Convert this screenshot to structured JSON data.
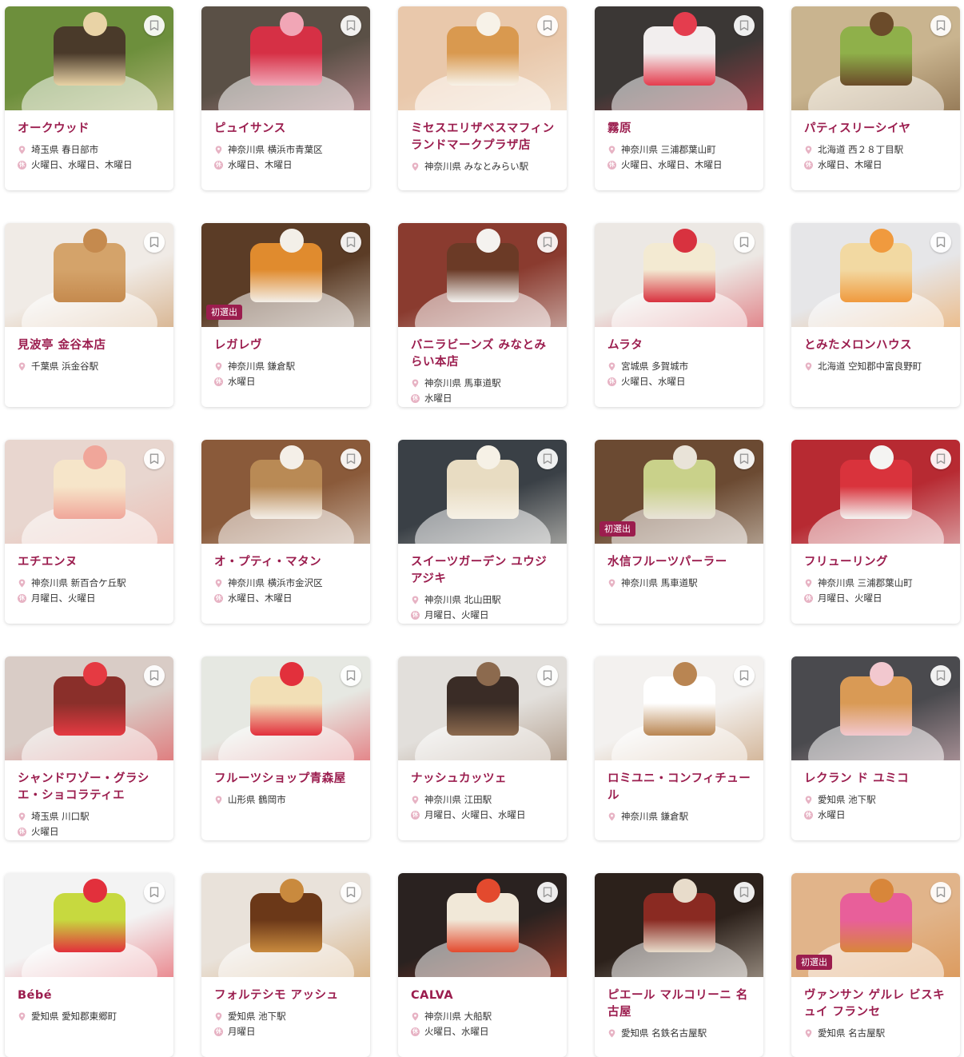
{
  "accent_color": "#9b1d4e",
  "shops": [
    {
      "name": "オークウッド",
      "location": "埼玉県 春日部市",
      "closed": "火曜日、水曜日、木曜日",
      "badge": "",
      "colors": [
        "#6d8f3c",
        "#4a3a2a",
        "#e9d3a6"
      ]
    },
    {
      "name": "ピュイサンス",
      "location": "神奈川県 横浜市青葉区",
      "closed": "水曜日、木曜日",
      "badge": "",
      "colors": [
        "#5a5046",
        "#d63045",
        "#f1a6b6"
      ]
    },
    {
      "name": "ミセスエリザベスマフィン ランドマークプラザ店",
      "location": "神奈川県 みなとみらい駅",
      "closed": "",
      "badge": "",
      "colors": [
        "#e9c8ab",
        "#d9994f",
        "#f7f2e8"
      ]
    },
    {
      "name": "霧原",
      "location": "神奈川県 三浦郡葉山町",
      "closed": "火曜日、水曜日、木曜日",
      "badge": "",
      "colors": [
        "#3b3735",
        "#f2eeee",
        "#e43d4e"
      ]
    },
    {
      "name": "パティスリーシイヤ",
      "location": "北海道 西２８丁目駅",
      "closed": "水曜日、木曜日",
      "badge": "",
      "colors": [
        "#c9b48f",
        "#8fb04a",
        "#6b4b2a"
      ]
    },
    {
      "name": "見波亭 金谷本店",
      "location": "千葉県 浜金谷駅",
      "closed": "",
      "badge": "",
      "colors": [
        "#f0ebe6",
        "#d4a36a",
        "#c58a4e"
      ]
    },
    {
      "name": "レガレヴ",
      "location": "神奈川県 鎌倉駅",
      "closed": "水曜日",
      "badge": "初選出",
      "colors": [
        "#5b3c26",
        "#e08b2e",
        "#f3efe8"
      ]
    },
    {
      "name": "バニラビーンズ みなとみらい本店",
      "location": "神奈川県 馬車道駅",
      "closed": "水曜日",
      "badge": "",
      "colors": [
        "#8a3b2f",
        "#6b3a26",
        "#f4f2ef"
      ]
    },
    {
      "name": "ムラタ",
      "location": "宮城県 多賀城市",
      "closed": "火曜日、水曜日",
      "badge": "",
      "colors": [
        "#ece8e4",
        "#f3ead2",
        "#d8323f"
      ]
    },
    {
      "name": "とみたメロンハウス",
      "location": "北海道 空知郡中富良野町",
      "closed": "",
      "badge": "",
      "colors": [
        "#e6e6e8",
        "#f2d9a2",
        "#f09a3e"
      ]
    },
    {
      "name": "エチエンヌ",
      "location": "神奈川県 新百合ケ丘駅",
      "closed": "月曜日、火曜日",
      "badge": "",
      "colors": [
        "#e8d6cf",
        "#f6e5c9",
        "#f0a69a"
      ]
    },
    {
      "name": "オ・プティ・マタン",
      "location": "神奈川県 横浜市金沢区",
      "closed": "水曜日、木曜日",
      "badge": "",
      "colors": [
        "#8a5a3a",
        "#b98a55",
        "#f4efe8"
      ]
    },
    {
      "name": "スイーツガーデン ユウジアジキ",
      "location": "神奈川県 北山田駅",
      "closed": "月曜日、火曜日",
      "badge": "",
      "colors": [
        "#3a4046",
        "#e8dcc2",
        "#f6f1e6"
      ]
    },
    {
      "name": "水信フルーツパーラー",
      "location": "神奈川県 馬車道駅",
      "closed": "",
      "badge": "初選出",
      "colors": [
        "#6b4a32",
        "#c9d18a",
        "#e9e3d8"
      ]
    },
    {
      "name": "フリューリング",
      "location": "神奈川県 三浦郡葉山町",
      "closed": "月曜日、火曜日",
      "badge": "",
      "colors": [
        "#b72a32",
        "#d9333c",
        "#f4f4f2"
      ]
    },
    {
      "name": "シャンドワゾー・グラシエ・ショコラティエ",
      "location": "埼玉県 川口駅",
      "closed": "火曜日",
      "badge": "",
      "colors": [
        "#d9ccc6",
        "#8a2f2a",
        "#e53a42"
      ]
    },
    {
      "name": "フルーツショップ青森屋",
      "location": "山形県 鶴岡市",
      "closed": "",
      "badge": "",
      "colors": [
        "#e6e8e2",
        "#f2dfb6",
        "#e2303c"
      ]
    },
    {
      "name": "ナッシュカッツェ",
      "location": "神奈川県 江田駅",
      "closed": "月曜日、火曜日、水曜日",
      "badge": "",
      "colors": [
        "#e2dfdb",
        "#3a2c26",
        "#8c6a4e"
      ]
    },
    {
      "name": "ロミユニ・コンフィチュール",
      "location": "神奈川県 鎌倉駅",
      "closed": "",
      "badge": "",
      "colors": [
        "#f3f1ef",
        "#ffffff",
        "#b98552"
      ]
    },
    {
      "name": "レクラン ド ユミコ",
      "location": "愛知県 池下駅",
      "closed": "水曜日",
      "badge": "",
      "colors": [
        "#4a4a4e",
        "#d99a55",
        "#f2c8cf"
      ]
    },
    {
      "name": "Bébé",
      "location": "愛知県 愛知郡東郷町",
      "closed": "",
      "badge": "",
      "colors": [
        "#f3f3f3",
        "#c7d93f",
        "#e2303c"
      ]
    },
    {
      "name": "フォルテシモ アッシュ",
      "location": "愛知県 池下駅",
      "closed": "月曜日",
      "badge": "",
      "colors": [
        "#e9e2da",
        "#6b3818",
        "#c98a3e"
      ]
    },
    {
      "name": "CALVA",
      "location": "神奈川県 大船駅",
      "closed": "火曜日、水曜日",
      "badge": "",
      "colors": [
        "#2a2220",
        "#f1e8d8",
        "#e34a2e"
      ]
    },
    {
      "name": "ピエール マルコリーニ 名古屋",
      "location": "愛知県 名鉄名古屋駅",
      "closed": "",
      "badge": "",
      "colors": [
        "#2c211b",
        "#8a2a22",
        "#e8dccb"
      ]
    },
    {
      "name": "ヴァンサン ゲルレ ビスキュイ フランセ",
      "location": "愛知県 名古屋駅",
      "closed": "",
      "badge": "初選出",
      "colors": [
        "#e1b48a",
        "#e85f9a",
        "#d8863a"
      ]
    }
  ]
}
